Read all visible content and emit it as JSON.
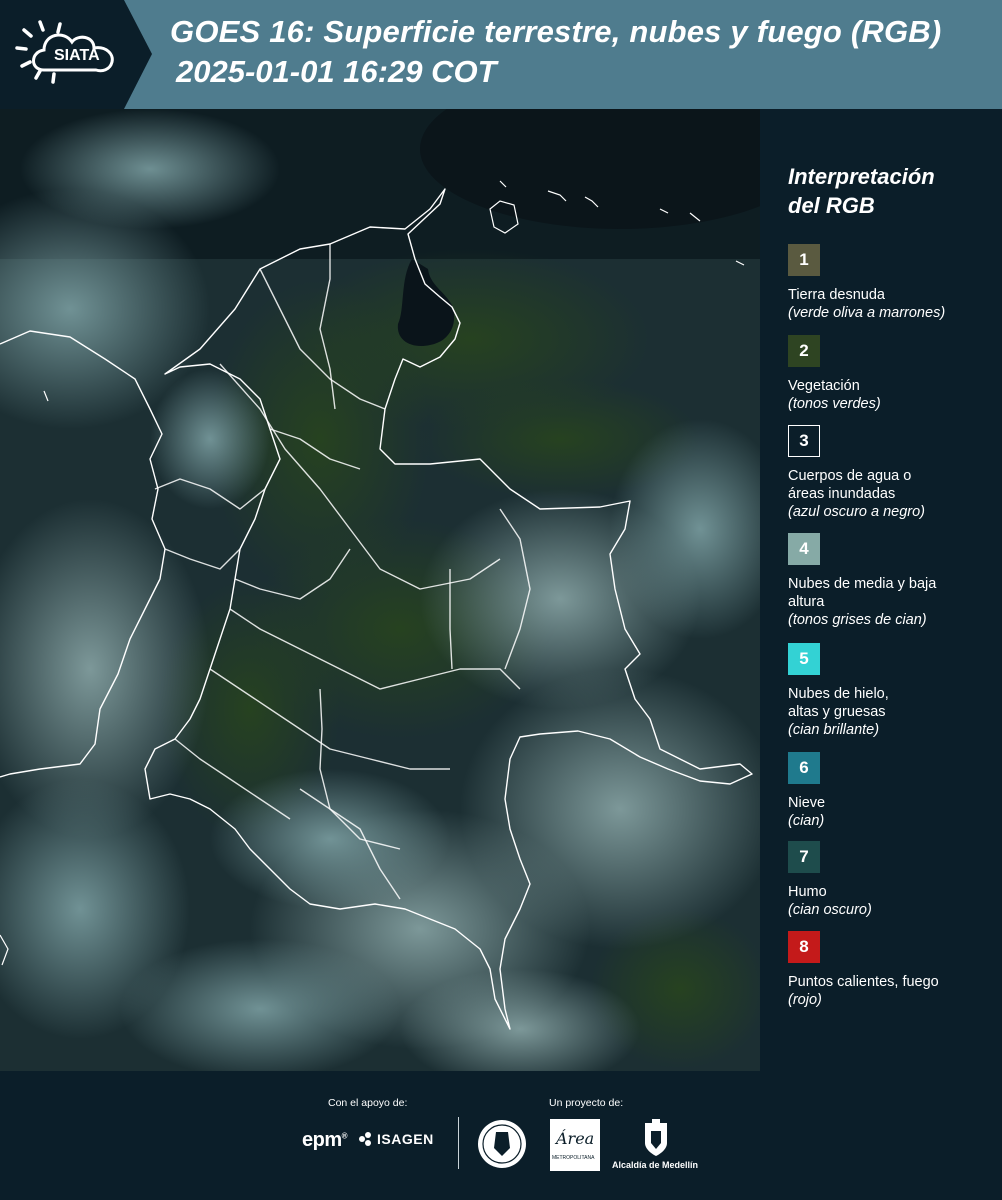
{
  "header": {
    "logo_text": "SIATA",
    "title": "GOES 16: Superficie terrestre, nubes y fuego (RGB)",
    "timestamp": "2025-01-01 16:29 COT"
  },
  "legend": {
    "title_line1": "Interpretación",
    "title_line2": "del RGB",
    "items": [
      {
        "number": "1",
        "color": "#5a5a40",
        "label": "Tierra desnuda",
        "note": "(verde oliva a marrones)"
      },
      {
        "number": "2",
        "color": "#2e4422",
        "label": "Vegetación",
        "note": "(tonos verdes)"
      },
      {
        "number": "3",
        "color": "#0b1e29",
        "label": "Cuerpos de agua o áreas inundadas",
        "note": "(azul oscuro a negro)"
      },
      {
        "number": "4",
        "color": "#86aaa6",
        "label": "Nubes de media y baja altura",
        "note": "(tonos grises de cian)"
      },
      {
        "number": "5",
        "color": "#33d2d4",
        "label": "Nubes de hielo, altas y gruesas",
        "note": "(cian brillante)"
      },
      {
        "number": "6",
        "color": "#1f7a8d",
        "label": "Nieve",
        "note": "(cian)"
      },
      {
        "number": "7",
        "color": "#1e4c4c",
        "label": "Humo",
        "note": "(cian oscuro)"
      },
      {
        "number": "8",
        "color": "#c41a1a",
        "label": "Puntos calientes, fuego",
        "note": "(rojo)"
      }
    ]
  },
  "footer": {
    "support_label": "Con el apoyo de:",
    "project_label": "Un proyecto de:",
    "sponsor_epm": "epm",
    "sponsor_isagen": "ISAGEN",
    "partner_area": "Área",
    "partner_area_sub": "METROPOLITANA",
    "partner_alcaldia": "Alcaldía de Medellín"
  }
}
